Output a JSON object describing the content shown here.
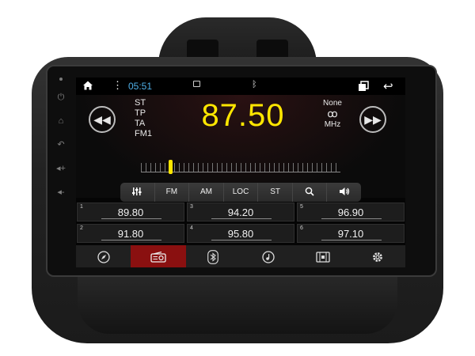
{
  "status": {
    "time": "05:51",
    "icons": [
      "home-icon",
      "menu-icon",
      "image-icon",
      "bluetooth-icon",
      "recent-apps-icon",
      "back-icon"
    ]
  },
  "radio": {
    "frequency": "87.50",
    "flags": [
      "ST",
      "TP",
      "TA",
      "FM1"
    ],
    "right": {
      "top": "None",
      "bottom": "MHz"
    },
    "needle_fraction": 0.14
  },
  "toolbar": {
    "items": [
      "FM",
      "AM",
      "LOC",
      "ST"
    ],
    "icons": [
      "equalizer-icon",
      "search-icon",
      "volume-icon"
    ]
  },
  "presets": [
    {
      "num": "1",
      "freq": "89.80"
    },
    {
      "num": "3",
      "freq": "94.20"
    },
    {
      "num": "5",
      "freq": "96.90"
    },
    {
      "num": "2",
      "freq": "91.80"
    },
    {
      "num": "4",
      "freq": "95.80"
    },
    {
      "num": "6",
      "freq": "97.10"
    }
  ],
  "dock": {
    "items": [
      "navigation-icon",
      "radio-icon",
      "bluetooth-icon",
      "music-icon",
      "video-icon",
      "settings-icon"
    ],
    "active": "radio-icon"
  },
  "colors": {
    "frequency": "#ffe600",
    "time": "#4fb0e8",
    "active_dock": "#8a1010"
  }
}
